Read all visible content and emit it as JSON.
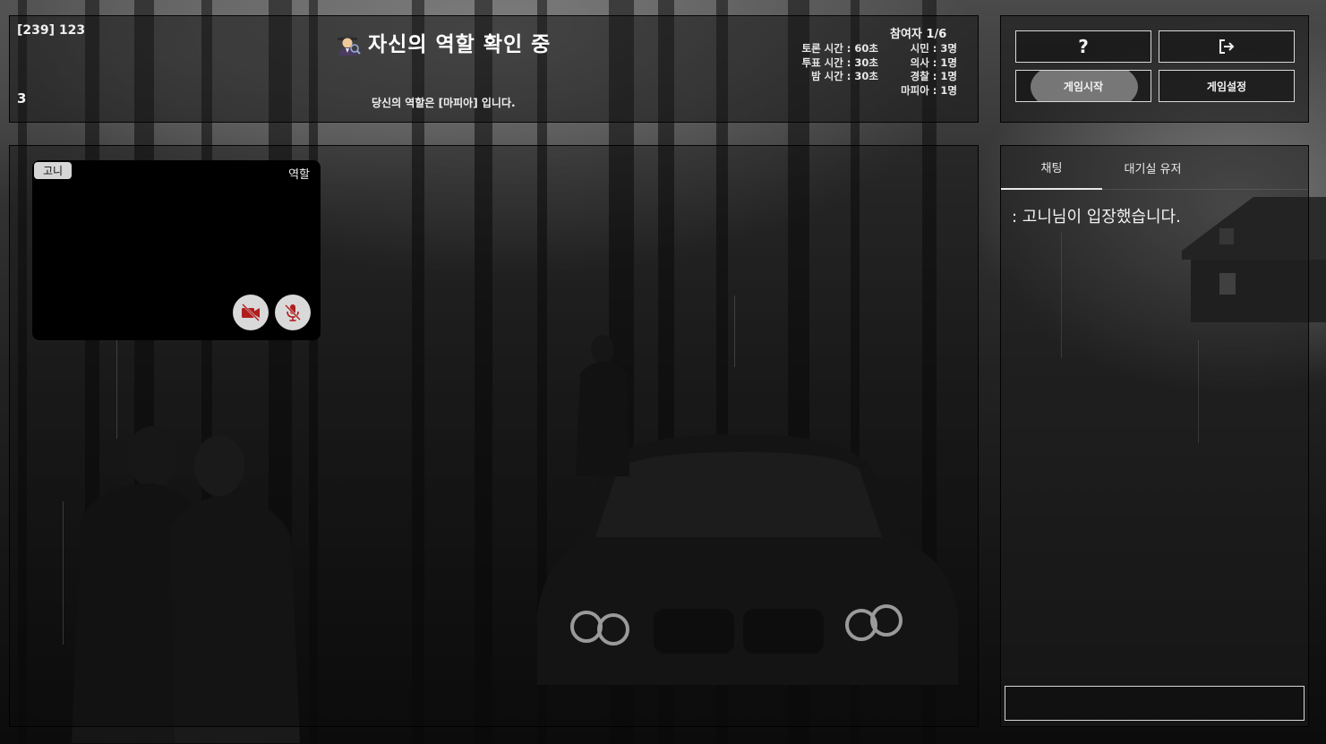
{
  "header": {
    "room_id": "[239] 123",
    "round_number": "3",
    "phase_title": "자신의 역할 확인 중",
    "phase_icon": "spy-detective-icon",
    "role_message": "당신의 역할은 [마피아] 입니다.",
    "participants": "참여자 1/6",
    "times": {
      "discussion": "토론 시간 : 60초",
      "vote": "투표 시간 : 30초",
      "night": "밤 시간 : 30초"
    },
    "roles": {
      "citizen": "시민 : 3명",
      "doctor": "의사 : 1명",
      "police": "경찰 : 1명",
      "mafia": "마피아 : 1명"
    }
  },
  "buttons": {
    "help_label": "?",
    "exit_icon": "exit-icon",
    "start_label": "게임시작",
    "settings_label": "게임설정"
  },
  "player_card": {
    "name": "고니",
    "role_label": "역할",
    "camera_icon": "camera-off-icon",
    "mic_icon": "mic-off-icon",
    "icon_color": "#b01e1e"
  },
  "chat": {
    "tabs": [
      "채팅",
      "대기실 유저"
    ],
    "messages": [
      ": 고니님이 입장했습니다."
    ],
    "input_value": "",
    "input_placeholder": ""
  }
}
